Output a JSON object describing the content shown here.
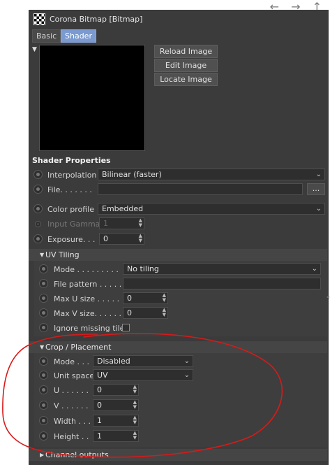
{
  "header": {
    "title": "Corona Bitmap [Bitmap]",
    "nav": "←  →  ↑",
    "icon": "checker-icon"
  },
  "tabs": [
    {
      "label": "Basic",
      "active": false
    },
    {
      "label": "Shader",
      "active": true
    }
  ],
  "buttons": {
    "reload": "Reload Image",
    "edit": "Edit Image",
    "locate": "Locate Image"
  },
  "shader_properties": {
    "title": "Shader Properties",
    "interpolation": {
      "label": "Interpolation",
      "value": "Bilinear (faster)"
    },
    "file": {
      "label": "File. . . . . . .",
      "value": "",
      "browse": "..."
    },
    "color_profile": {
      "label": "Color profile",
      "value": "Embedded"
    },
    "input_gamma": {
      "label": "Input Gamma",
      "value": "1"
    },
    "exposure": {
      "label": "Exposure. . .",
      "value": "0"
    }
  },
  "uv_tiling": {
    "title": "UV Tiling",
    "mode": {
      "label": "Mode . . . . . . . . .",
      "value": "No tiling"
    },
    "file_pattern": {
      "label": "File pattern . . . . .",
      "value": ""
    },
    "max_u": {
      "label": "Max U size . . . . .",
      "value": "0"
    },
    "max_v": {
      "label": "Max V size. . . . . .",
      "value": "0"
    },
    "ignore_missing": {
      "label": "Ignore missing tiles",
      "checked": false
    }
  },
  "crop_placement": {
    "title": "Crop / Placement",
    "mode": {
      "label": "Mode . . .",
      "value": "Disabled"
    },
    "unit_space": {
      "label": "Unit space",
      "value": "UV"
    },
    "u": {
      "label": "U . . . . . .",
      "value": "0"
    },
    "v": {
      "label": "V . . . . . .",
      "value": "0"
    },
    "width": {
      "label": "Width . . .",
      "value": "1"
    },
    "height": {
      "label": "Height . .",
      "value": "1"
    }
  },
  "channel_outputs": {
    "title": "Channel outputs"
  },
  "colors": {
    "panel_bg": "#3b3b3b",
    "active_tab": "#7a9ad0",
    "annotation": "#d81a1a"
  }
}
